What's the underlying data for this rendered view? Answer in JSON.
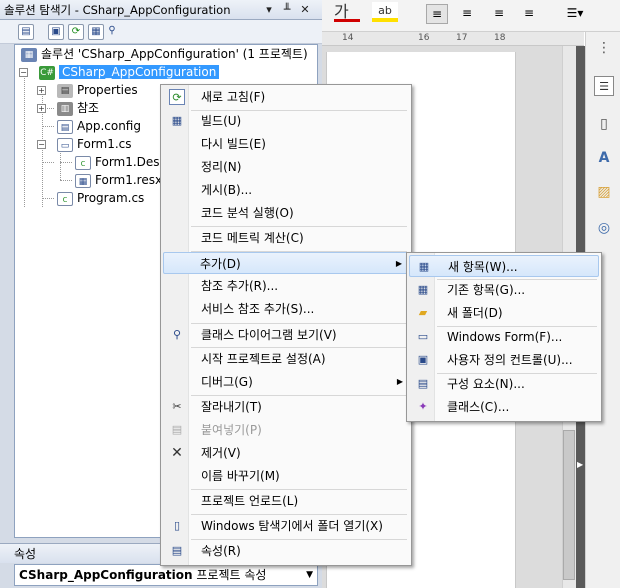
{
  "solution_explorer": {
    "title": "솔루션 탐색기 - CSharp_AppConfiguration",
    "pin": "▾ ╨ ✕",
    "tree": {
      "solution": "솔루션 'CSharp_AppConfiguration' (1 프로젝트)",
      "project": "CSharp_AppConfiguration",
      "properties": "Properties",
      "references": "참조",
      "appconfig": "App.config",
      "form1": "Form1.cs",
      "form1_designer": "Form1.Des",
      "form1_resx": "Form1.resx",
      "program": "Program.cs"
    }
  },
  "properties_panel": {
    "title": "속성",
    "selected_object": "CSharp_AppConfiguration",
    "object_type": "프로젝트 속성"
  },
  "ruler": {
    "marks": [
      "14",
      "16",
      "17",
      "18"
    ]
  },
  "context_menu": {
    "items": [
      {
        "label": "새로 고침(F)"
      },
      {
        "label": "빌드(U)"
      },
      {
        "label": "다시 빌드(E)"
      },
      {
        "label": "정리(N)"
      },
      {
        "label": "게시(B)..."
      },
      {
        "label": "코드 분석 실행(O)"
      },
      {
        "label": "코드 메트릭 계산(C)"
      },
      {
        "label": "추가(D)"
      },
      {
        "label": "참조 추가(R)..."
      },
      {
        "label": "서비스 참조 추가(S)..."
      },
      {
        "label": "클래스 다이어그램 보기(V)"
      },
      {
        "label": "시작 프로젝트로 설정(A)"
      },
      {
        "label": "디버그(G)"
      },
      {
        "label": "잘라내기(T)"
      },
      {
        "label": "붙여넣기(P)"
      },
      {
        "label": "제거(V)"
      },
      {
        "label": "이름 바꾸기(M)"
      },
      {
        "label": "프로젝트 언로드(L)"
      },
      {
        "label": "Windows 탐색기에서 폴더 열기(X)"
      },
      {
        "label": "속성(R)"
      }
    ]
  },
  "submenu": {
    "items": [
      {
        "label": "새 항목(W)..."
      },
      {
        "label": "기존 항목(G)..."
      },
      {
        "label": "새 폴더(D)"
      },
      {
        "label": "Windows Form(F)..."
      },
      {
        "label": "사용자 정의 컨트롤(U)..."
      },
      {
        "label": "구성 요소(N)..."
      },
      {
        "label": "클래스(C)..."
      }
    ]
  },
  "ribbon_text": "가"
}
